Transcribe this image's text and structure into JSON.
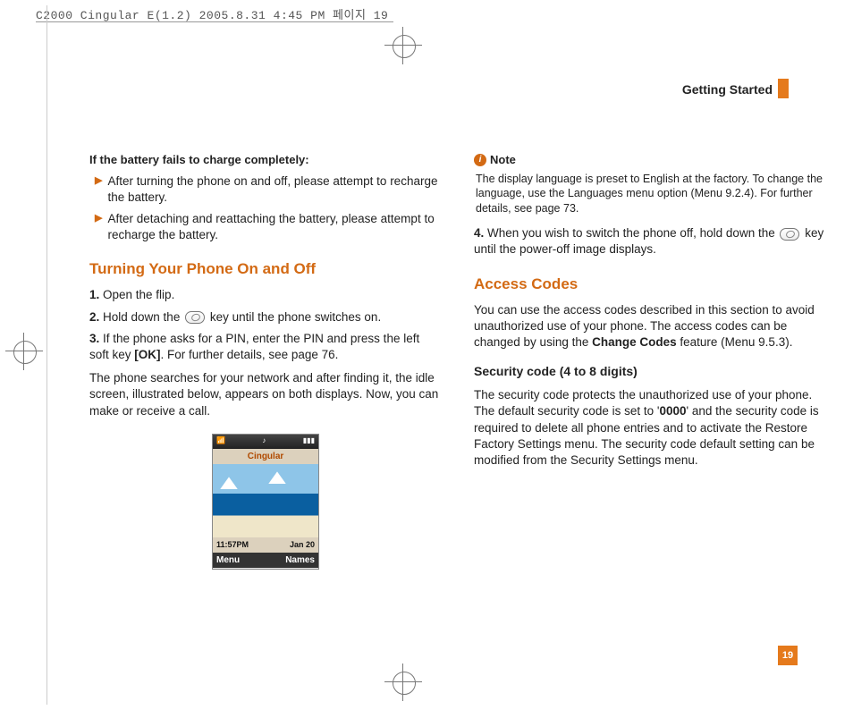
{
  "meta": {
    "print_header": "C2000 Cingular E(1.2)  2005.8.31 4:45 PM  페이지 19"
  },
  "running_head": "Getting Started",
  "page_number": "19",
  "left": {
    "battery_title": "If the battery fails to charge completely:",
    "battery_bullets": [
      "After turning the phone on and off, please attempt to recharge the battery.",
      "After detaching and reattaching the battery, please attempt to recharge the battery."
    ],
    "heading": "Turning Your Phone On and Off",
    "step1_num": "1.",
    "step1_text": " Open the flip.",
    "step2_num": "2.",
    "step2_pre": " Hold down the ",
    "step2_post": " key until the phone switches on.",
    "step3_num": "3.",
    "step3_text_a": "  If the phone asks for a PIN, enter the PIN and press the left soft key ",
    "step3_ok": "[OK]",
    "step3_text_b": ". For further details, see page 76.",
    "search_para": "The phone searches for your network and after finding it, the idle screen, illustrated below, appears on both displays. Now, you can make or receive a call.",
    "screenshot": {
      "carrier": "Cingular",
      "time": "11:57PM",
      "date": "Jan 20",
      "soft_left": "Menu",
      "soft_right": "Names"
    }
  },
  "right": {
    "note_label": "Note",
    "note_body": "The display language is preset to English at the factory. To change the language, use the Languages menu option (Menu 9.2.4). For further details, see page 73.",
    "step4_num": "4.",
    "step4_pre": " When you wish to switch the phone off, hold down the ",
    "step4_post": " key until the power-off image displays.",
    "access_heading": "Access Codes",
    "access_para_a": "You can use the access codes described in this section to avoid unauthorized use of your phone. The access codes can be changed by using the ",
    "access_bold": "Change Codes",
    "access_para_b": " feature (Menu 9.5.3).",
    "sec_heading": "Security code (4 to 8 digits)",
    "sec_para_a": "The security code protects the unauthorized use of your phone. The default security code is set to '",
    "sec_default": "0000",
    "sec_para_b": "' and the security code is required to delete all phone entries and to activate the Restore Factory Settings menu. The security code default setting can be modified from the Security Settings menu."
  }
}
